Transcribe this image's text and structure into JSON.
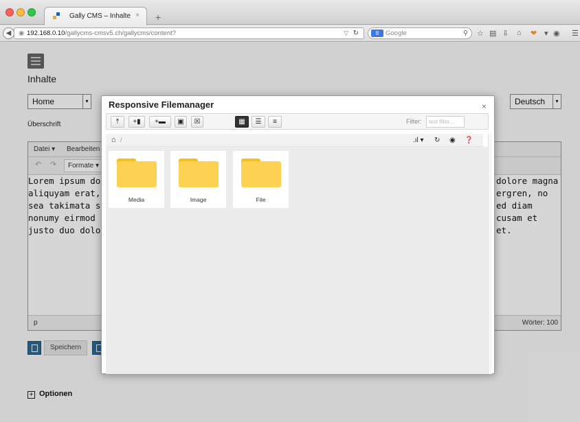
{
  "browser": {
    "tab_title": "Gally CMS – Inhalte",
    "tab_close": "×",
    "new_tab": "+",
    "url_host": "192.168.0.10",
    "url_path": "/gallycms-cmsv5.ch/gallycms/content?",
    "search_engine": "8",
    "search_placeholder": "Google"
  },
  "page": {
    "heading": "Inhalte",
    "page_select": "Home",
    "language_select": "Deutsch",
    "field_label": "Überschrift",
    "editor": {
      "menu": [
        "Datei ▾",
        "Bearbeiten"
      ],
      "formats": "Formate ▾",
      "text_left": [
        "Lorem ipsum dolo",
        "aliquyam erat, se",
        "sea takimata sanc",
        "nonumy eirmod te",
        "justo duo dolores"
      ],
      "text_right": [
        "dolore magna",
        "ergren, no",
        "ed diam",
        "cusam et",
        "et."
      ],
      "status_path": "p",
      "word_count": "Wörter: 100"
    },
    "save_label": "Speichern",
    "options_label": "Optionen",
    "options_plus": "+"
  },
  "modal": {
    "title": "Responsive Filemanager",
    "close": "×",
    "filter_label": "Filter:",
    "filter_placeholder": "text filter...",
    "breadcrumb_sep": "/",
    "sort_label": ".ıl ▾",
    "folders": [
      {
        "name": "Media"
      },
      {
        "name": "Image"
      },
      {
        "name": "File"
      }
    ]
  },
  "colors": {
    "accent_blue": "#2a6d9c",
    "folder_yellow": "#fdd152",
    "folder_tab": "#f3c020"
  }
}
